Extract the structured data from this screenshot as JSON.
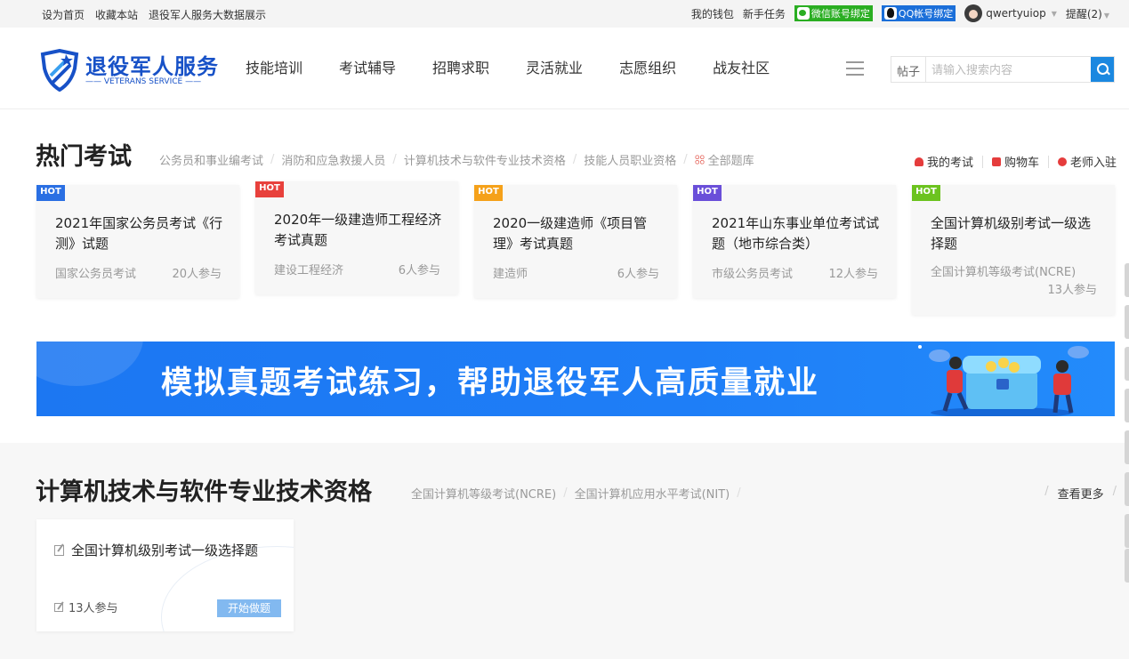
{
  "topbar": {
    "links": [
      "设为首页",
      "收藏本站",
      "退役军人服务大数据展示"
    ],
    "wallet": "我的钱包",
    "newbie": "新手任务",
    "wechat_bind": "微信账号绑定",
    "qq_bind": "QQ帐号绑定",
    "username": "qwertyuiop",
    "reminder": "提醒(2)"
  },
  "header": {
    "logo_title": "退役军人服务",
    "logo_sub": "VETERANS SERVICE",
    "nav": [
      "技能培训",
      "考试辅导",
      "招聘求职",
      "灵活就业",
      "志愿组织",
      "战友社区"
    ],
    "search_scope": "帖子",
    "search_placeholder": "请输入搜索内容"
  },
  "hot": {
    "title": "热门考试",
    "categories": [
      "公务员和事业编考试",
      "消防和应急救援人员",
      "计算机技术与软件专业技术资格",
      "技能人员职业资格",
      "全部题库"
    ],
    "quick": [
      "我的考试",
      "购物车",
      "老师入驻"
    ],
    "cards": [
      {
        "badge": "HOT",
        "badge_color": "#2a6fe3",
        "title": "2021年国家公务员考试《行测》试题",
        "category": "国家公务员考试",
        "count": "20人参与"
      },
      {
        "badge": "HOT",
        "badge_color": "#e8413c",
        "title": "2020年一级建造师工程经济考试真题",
        "category": "建设工程经济",
        "count": "6人参与"
      },
      {
        "badge": "HOT",
        "badge_color": "#f5a11a",
        "title": "2020一级建造师《项目管理》考试真题",
        "category": "建造师",
        "count": "6人参与"
      },
      {
        "badge": "HOT",
        "badge_color": "#6a4fd9",
        "title": "2021年山东事业单位考试试题（地市综合类）",
        "category": "市级公务员考试",
        "count": "12人参与"
      },
      {
        "badge": "HOT",
        "badge_color": "#6cc31f",
        "title": "全国计算机级别考试一级选择题",
        "category": "全国计算机等级考试(NCRE)",
        "count": "13人参与"
      }
    ]
  },
  "banner": {
    "text": "模拟真题考试练习，帮助退役军人高质量就业"
  },
  "computer": {
    "title": "计算机技术与软件专业技术资格",
    "subcats": [
      "全国计算机等级考试(NCRE)",
      "全国计算机应用水平考试(NIT)"
    ],
    "more": "查看更多",
    "exam": {
      "title": "全国计算机级别考试一级选择题",
      "count": "13人参与",
      "button": "开始做题"
    }
  }
}
